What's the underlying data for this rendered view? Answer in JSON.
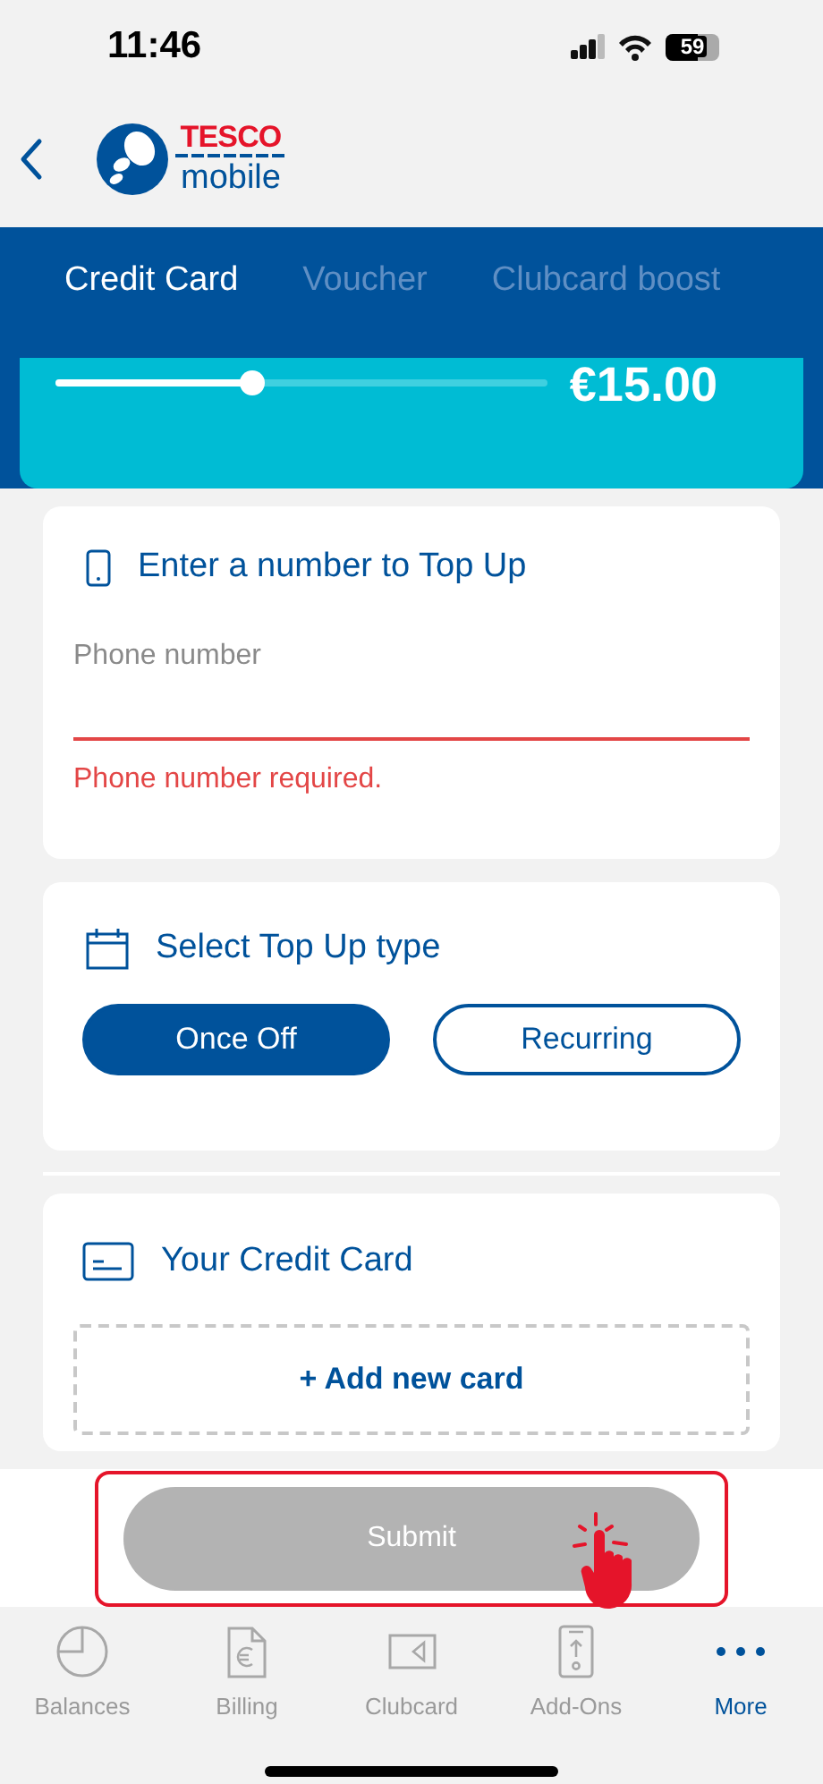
{
  "status_bar": {
    "time": "11:46",
    "battery": "59"
  },
  "header": {
    "brand_top": "TESCO",
    "brand_bottom": "mobile"
  },
  "tabs": [
    {
      "label": "Credit Card",
      "selected": true
    },
    {
      "label": "Voucher",
      "selected": false
    },
    {
      "label": "Clubcard boost",
      "selected": false
    }
  ],
  "amount": {
    "level": 0.4,
    "value": "€15.00"
  },
  "number_section": {
    "title": "Enter a number to Top Up",
    "placeholder": "Phone number",
    "error": "Phone number required."
  },
  "type_section": {
    "title": "Select Top Up type",
    "options": [
      {
        "label": "Once Off",
        "selected": true
      },
      {
        "label": "Recurring",
        "selected": false
      }
    ]
  },
  "card_section": {
    "title": "Your Credit Card",
    "add_button": "+ Add new card"
  },
  "submit": {
    "label": "Submit",
    "disabled": true,
    "highlighted": true
  },
  "nav": [
    {
      "label": "Balances",
      "kind": "pie",
      "selected": false
    },
    {
      "label": "Billing",
      "kind": "bill",
      "selected": false
    },
    {
      "label": "Clubcard",
      "kind": "card",
      "selected": false
    },
    {
      "label": "Add-Ons",
      "kind": "phone",
      "selected": false
    },
    {
      "label": "More",
      "kind": "more",
      "selected": true
    }
  ]
}
